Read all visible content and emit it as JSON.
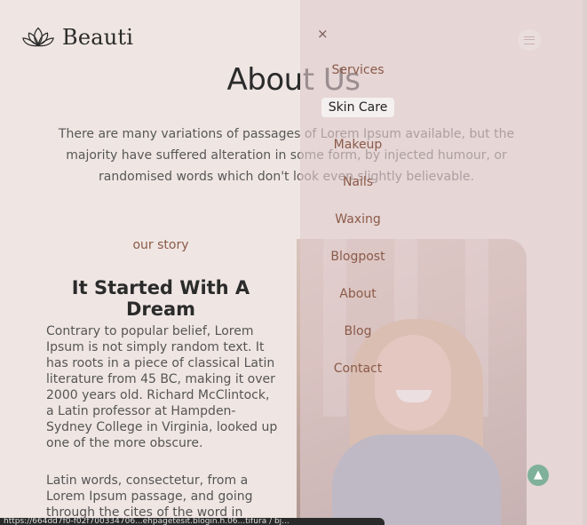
{
  "brand": {
    "name": "Beauti",
    "logo_icon": "lotus-icon"
  },
  "hero": {
    "title": "About Us",
    "text": "There are many variations of passages of Lorem Ipsum available, but the majority have suffered alteration in some form, by injected humour, or randomised words which don't look even slightly believable."
  },
  "story": {
    "kicker": "our story",
    "title": "It Started With A Dream",
    "p1": "Contrary to popular belief, Lorem Ipsum is not simply random text. It has roots in a piece of classical Latin literature from 45 BC, making it over 2000 years old. Richard McClintock, a Latin professor at Hampden-Sydney College in Virginia, looked up one of the more obscure.",
    "p2": "Latin words, consectetur, from a Lorem Ipsum passage, and going through the cites of the word in classical literature,"
  },
  "menu": {
    "close_label": "×",
    "items": [
      {
        "label": "Services",
        "active": false
      },
      {
        "label": "Skin Care",
        "active": true
      },
      {
        "label": "Makeup",
        "active": false
      },
      {
        "label": "Nails",
        "active": false
      },
      {
        "label": "Waxing",
        "active": false
      },
      {
        "label": "Blogpost",
        "active": false
      },
      {
        "label": "About",
        "active": false
      },
      {
        "label": "Blog",
        "active": false
      },
      {
        "label": "Contact",
        "active": false
      }
    ]
  },
  "status": {
    "url": "https://664dd7f0-f02f700334706...ehpagetesit.blogin.h.06...tifura / bj..."
  },
  "icons": {
    "menu": "hamburger-icon",
    "back_top": "arrow-up-icon",
    "close": "close-icon"
  },
  "colors": {
    "accent": "#8a5a48",
    "overlay": "#e0ccce",
    "back_top": "#7fb09a"
  }
}
